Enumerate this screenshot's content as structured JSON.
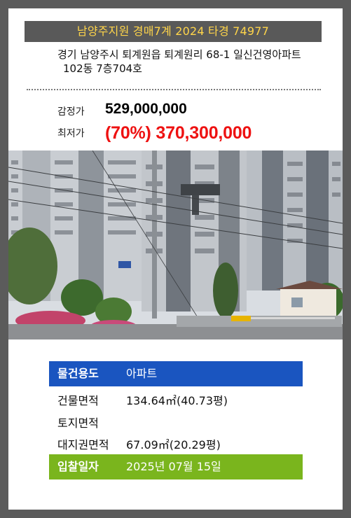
{
  "header": {
    "title": "남양주지원 경매7계 2024 타경 74977"
  },
  "address": {
    "line1": "경기 남양주시 퇴계원읍 퇴계원리 68-1 일신건영아파트",
    "line2": "102동 7층704호"
  },
  "prices": {
    "appraisal_label": "감정가",
    "appraisal_value": "529,000,000",
    "minimum_label": "최저가",
    "minimum_value": "(70%) 370,300,000"
  },
  "photo": {
    "icon": "apartment-photo"
  },
  "details": {
    "usage_label": "물건용도",
    "usage_value": "아파트",
    "building_area_label": "건물면적",
    "building_area_value": "134.64㎡(40.73평)",
    "land_area_label": "토지면적",
    "land_area_value": "",
    "land_right_area_label": "대지권면적",
    "land_right_area_value": "67.09㎡(20.29평)",
    "bid_date_label": "입찰일자",
    "bid_date_value": "2025년 07월 15일"
  },
  "colors": {
    "header_bg": "#595959",
    "header_text": "#ffd54a",
    "minimum_price": "#ee1111",
    "usage_row": "#1a55c0",
    "bid_date_row": "#7ab51d"
  }
}
